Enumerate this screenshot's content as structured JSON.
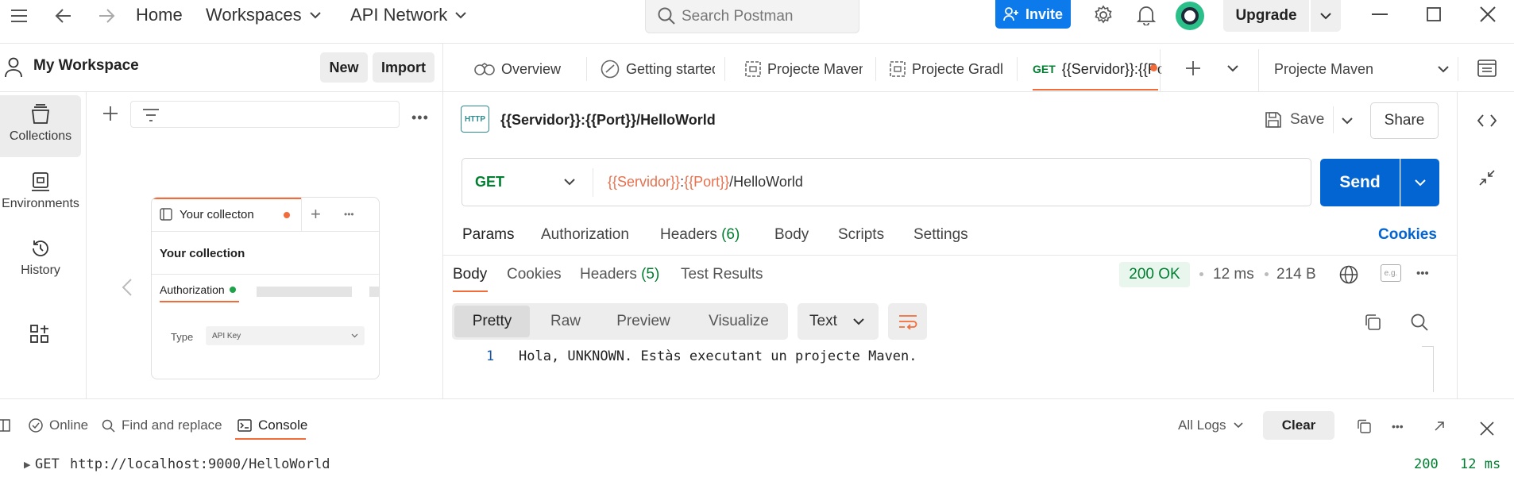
{
  "titlebar": {
    "home": "Home",
    "workspaces": "Workspaces",
    "api_network": "API Network",
    "search_placeholder": "Search Postman",
    "invite": "Invite",
    "upgrade": "Upgrade"
  },
  "workspace": {
    "name": "My Workspace",
    "new_label": "New",
    "import_label": "Import"
  },
  "sidebar": {
    "items": [
      {
        "label": "Collections",
        "icon": "collections-icon"
      },
      {
        "label": "Environments",
        "icon": "environments-icon"
      },
      {
        "label": "History",
        "icon": "history-icon"
      }
    ]
  },
  "preview_card": {
    "tab_label": "Your collecton",
    "title": "Your collection",
    "auth_label": "Authorization",
    "type_label": "Type",
    "type_value": "API Key"
  },
  "tabs": [
    {
      "label": "Overview"
    },
    {
      "label": "Getting started"
    },
    {
      "label": "Projecte Maven"
    },
    {
      "label": "Projecte Gradle"
    },
    {
      "method": "GET",
      "label": "{{Servidor}}:{{Port}}/HelloWorld"
    }
  ],
  "environment": {
    "selected": "Projecte Maven"
  },
  "request": {
    "title": "{{Servidor}}:{{Port}}/HelloWorld",
    "save_label": "Save",
    "share_label": "Share",
    "method": "GET",
    "url_var1": "{{Servidor}}",
    "url_sep": ":",
    "url_var2": "{{Port}}",
    "url_path": "/HelloWorld",
    "send_label": "Send",
    "tabs": {
      "params": "Params",
      "authorization": "Authorization",
      "headers": "Headers",
      "headers_count": "(6)",
      "body": "Body",
      "scripts": "Scripts",
      "settings": "Settings",
      "cookies": "Cookies"
    }
  },
  "response": {
    "tabs": {
      "body": "Body",
      "cookies": "Cookies",
      "headers": "Headers",
      "headers_count": "(5)",
      "test_results": "Test Results"
    },
    "status": "200 OK",
    "time": "12 ms",
    "size": "214 B",
    "views": {
      "pretty": "Pretty",
      "raw": "Raw",
      "preview": "Preview",
      "visualize": "Visualize"
    },
    "format": "Text",
    "eg_label": "e.g.",
    "line_number": "1",
    "body_text": "Hola, UNKNOWN. Estàs executant un projecte Maven."
  },
  "console_bar": {
    "online": "Online",
    "find_replace": "Find and replace",
    "console": "Console",
    "all_logs": "All Logs",
    "clear": "Clear"
  },
  "console_log": {
    "method": "GET",
    "url": "http://localhost:9000/HelloWorld",
    "status": "200",
    "time": "12 ms"
  },
  "colors": {
    "accent_orange": "#f26b3a",
    "send_blue": "#0265d2",
    "invite_blue": "#0c7aeb",
    "status_green": "#007f31",
    "var_orange": "#e8704d"
  }
}
